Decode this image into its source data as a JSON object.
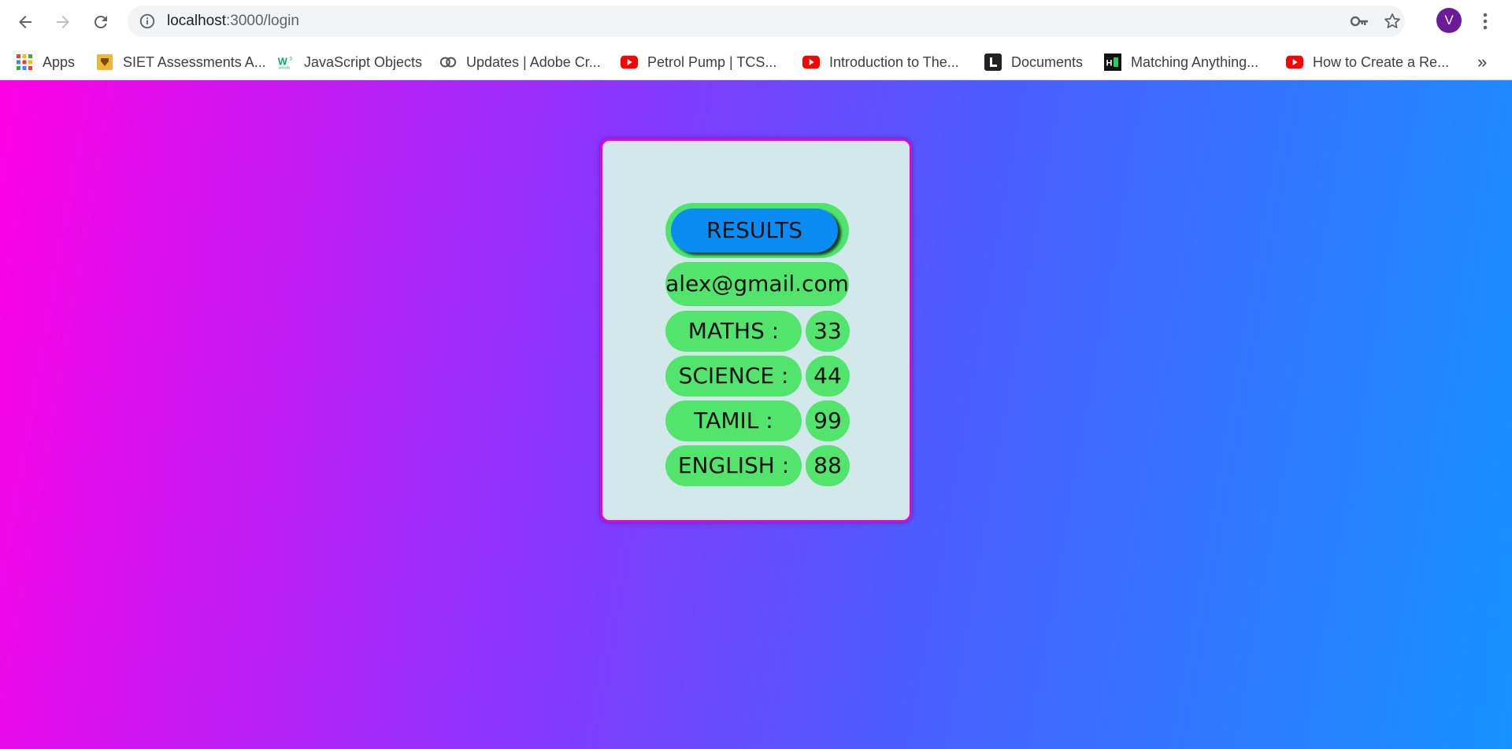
{
  "browser": {
    "url_host": "localhost",
    "url_path": ":3000/login",
    "profile_initial": "V",
    "bookmarks_overflow": "»"
  },
  "bookmarks": [
    {
      "label": "Apps",
      "icon": "apps-grid-icon"
    },
    {
      "label": "SIET Assessments A...",
      "icon": "siet-icon"
    },
    {
      "label": "JavaScript Objects",
      "icon": "w3schools-icon"
    },
    {
      "label": "Updates | Adobe Cr...",
      "icon": "adobe-cc-icon"
    },
    {
      "label": "Petrol Pump | TCS...",
      "icon": "youtube-icon"
    },
    {
      "label": "Introduction to The...",
      "icon": "youtube-icon"
    },
    {
      "label": "Documents",
      "icon": "lumin-icon"
    },
    {
      "label": "Matching Anything...",
      "icon": "hackerrank-icon"
    },
    {
      "label": "How to Create a Re...",
      "icon": "youtube-icon"
    }
  ],
  "card": {
    "results_label": "RESULTS",
    "email": "alex@gmail.com",
    "subjects": [
      {
        "label": "MATHS :",
        "score": "33"
      },
      {
        "label": "SCIENCE :",
        "score": "44"
      },
      {
        "label": "TAMIL :",
        "score": "99"
      },
      {
        "label": "ENGLISH :",
        "score": "88"
      }
    ]
  },
  "colors": {
    "gradient_left": "#ff00e6",
    "gradient_right": "#1693ff",
    "card_bg": "#d3e8ea",
    "card_border": "#e600e6",
    "pill_green": "#52e46d",
    "results_blue": "#0a8cf5",
    "avatar_purple": "#6a1b9a"
  }
}
